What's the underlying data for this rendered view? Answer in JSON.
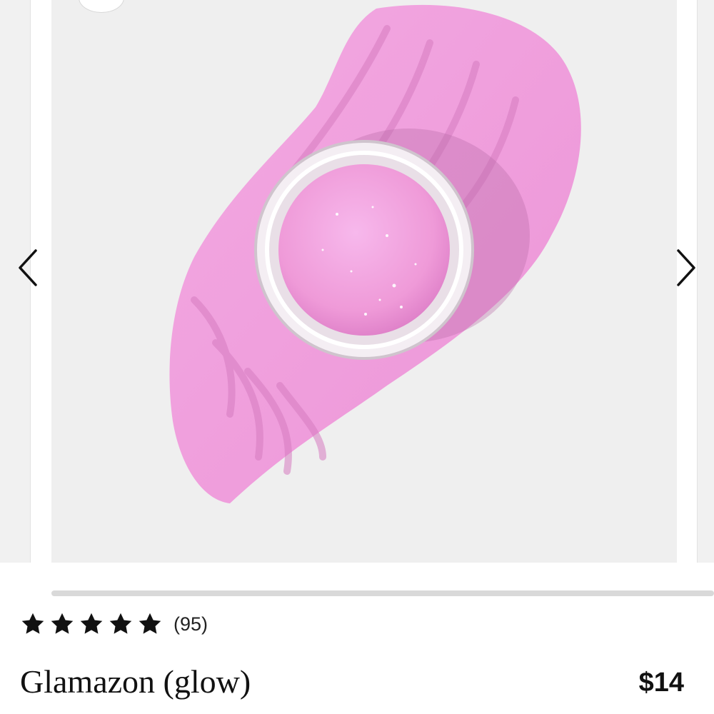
{
  "carousel": {
    "image_alt": "Pink glitter powder pot on textured swatch",
    "prev_icon": "chevron-left-icon",
    "next_icon": "chevron-right-icon"
  },
  "product": {
    "rating_stars": 5,
    "review_count": "(95)",
    "title": "Glamazon (glow)",
    "price": "$14"
  },
  "colors": {
    "swatch_pink": "#f19fdd",
    "background": "#efefef",
    "text": "#111111",
    "track": "#d9d9d9"
  }
}
